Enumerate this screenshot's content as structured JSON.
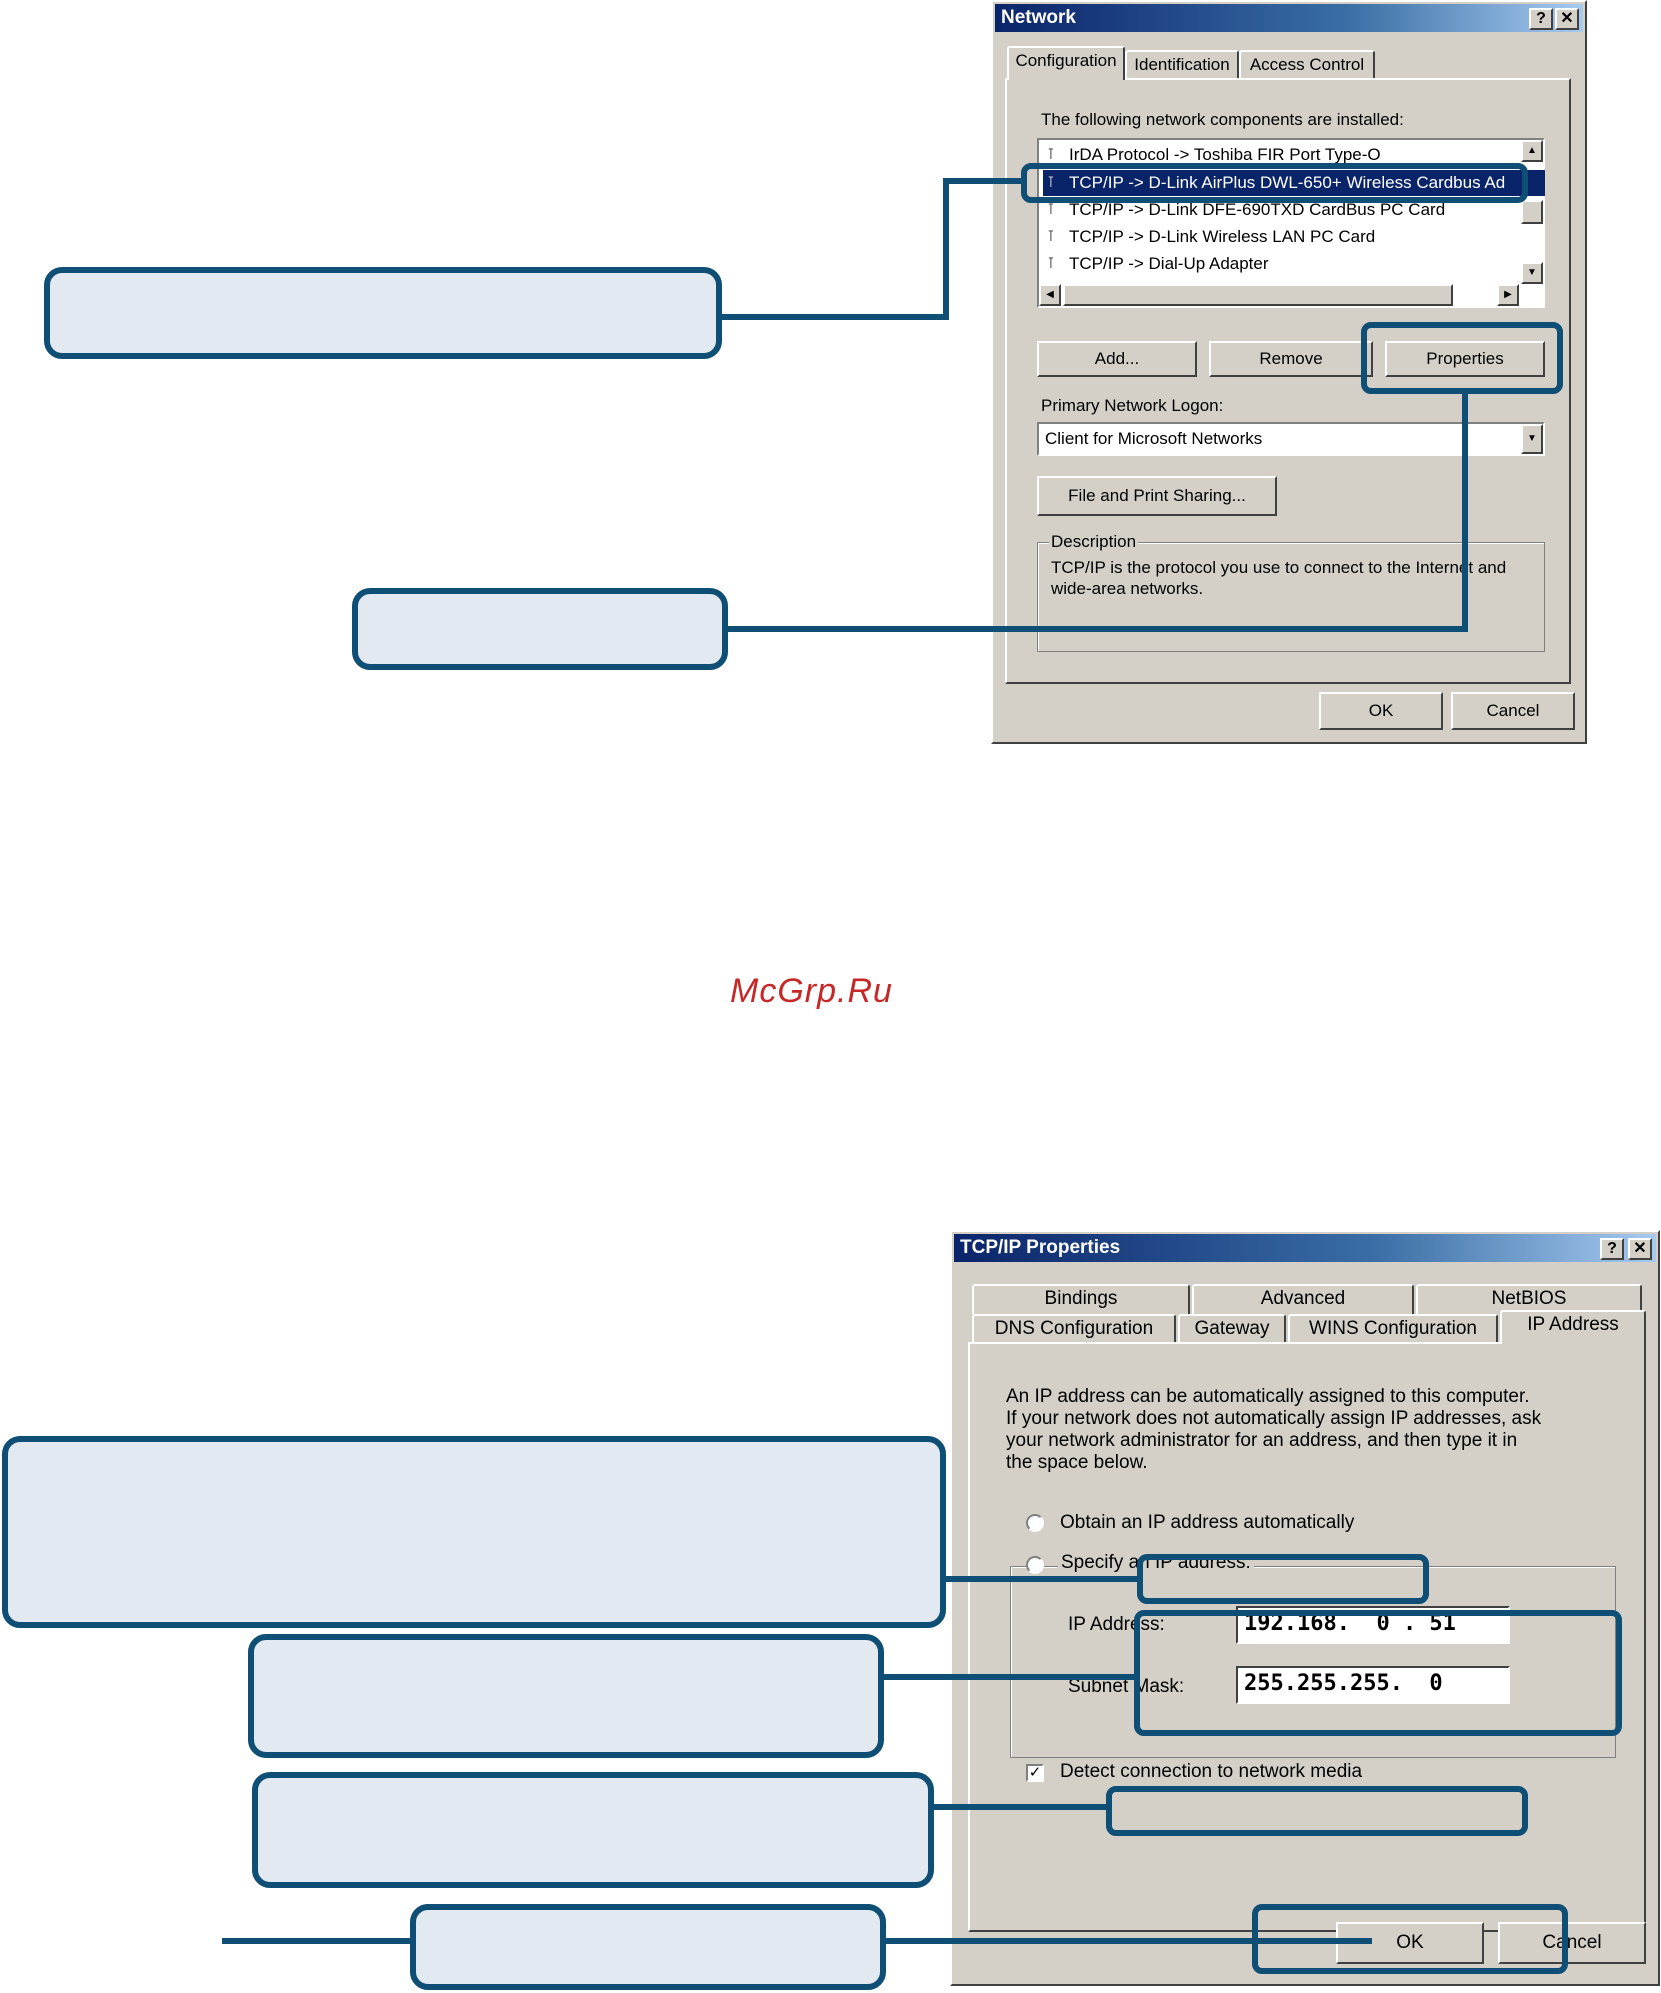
{
  "network_dialog": {
    "title": "Network",
    "help_btn": "?",
    "close_btn": "✕",
    "tabs": [
      "Configuration",
      "Identification",
      "Access Control"
    ],
    "components_label": "The following network components are installed:",
    "components": [
      "IrDA Protocol -> Toshiba FIR Port Type-O",
      "TCP/IP -> D-Link AirPlus DWL-650+ Wireless  Cardbus Ad",
      "TCP/IP -> D-Link DFE-690TXD CardBus PC Card",
      "TCP/IP -> D-Link Wireless LAN PC Card",
      "TCP/IP -> Dial-Up Adapter"
    ],
    "selected_index": 1,
    "add_btn": "Add...",
    "remove_btn": "Remove",
    "properties_btn": "Properties",
    "primary_logon_label": "Primary Network Logon:",
    "primary_logon_value": "Client for Microsoft Networks",
    "file_print_btn": "File and Print Sharing...",
    "description_label": "Description",
    "description_text_1": "TCP/IP is the protocol you use to connect to the Internet and",
    "description_text_2": "wide-area networks.",
    "ok_btn": "OK",
    "cancel_btn": "Cancel"
  },
  "watermark": "McGrp.Ru",
  "tcpip_dialog": {
    "title": "TCP/IP Properties",
    "help_btn": "?",
    "close_btn": "✕",
    "tabs_row1": [
      "Bindings",
      "Advanced",
      "NetBIOS"
    ],
    "tabs_row2": [
      "DNS Configuration",
      "Gateway",
      "WINS Configuration",
      "IP Address"
    ],
    "info_1": "An IP address can be automatically assigned to this computer.",
    "info_2": "If your network does not automatically assign IP addresses, ask",
    "info_3": "your network administrator for an address, and then type it in",
    "info_4": "the space below.",
    "obtain_auto": "Obtain an IP address automatically",
    "specify": "Specify an IP address:",
    "ip_label": "IP Address:",
    "ip_value": "192.168.  0 . 51",
    "subnet_label": "Subnet Mask:",
    "subnet_value": "255.255.255.  0",
    "detect": "Detect connection to network media",
    "ok_btn": "OK",
    "cancel_btn": "Cancel"
  }
}
